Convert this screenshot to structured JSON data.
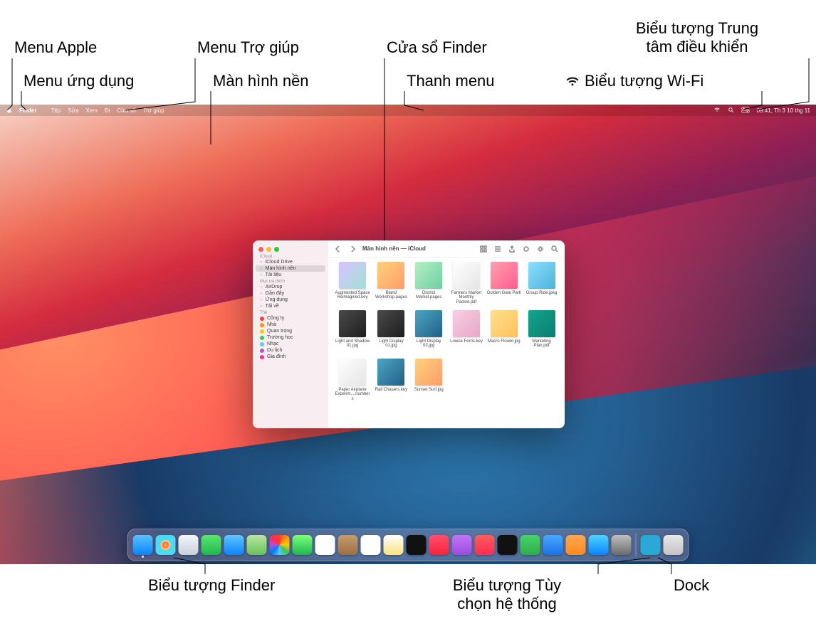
{
  "annotations": {
    "apple_menu": "Menu Apple",
    "app_menu": "Menu ứng dụng",
    "help_menu": "Menu Trợ giúp",
    "desktop": "Màn hình nền",
    "finder_window": "Cửa sổ Finder",
    "menu_bar": "Thanh menu",
    "control_center_l1": "Biểu tượng Trung",
    "control_center_l2": "tâm điều khiển",
    "wifi_icon": "Biểu tượng Wi-Fi",
    "finder_icon": "Biểu tượng Finder",
    "syspref_l1": "Biểu tượng Tùy",
    "syspref_l2": "chọn hệ thống",
    "dock": "Dock"
  },
  "menubar": {
    "app_name": "Finder",
    "items": [
      "Tệp",
      "Sửa",
      "Xem",
      "Đi",
      "Cửa sổ",
      "Trợ giúp"
    ],
    "clock": "09:41, Th 3 10 thg 11"
  },
  "finder": {
    "title": "Màn hình nền — iCloud",
    "sidebar": {
      "section_icloud": "iCloud",
      "icloud_items": [
        "iCloud Drive",
        "Màn hình nền",
        "Tài liệu"
      ],
      "section_fav": "Mục ưa thích",
      "fav_items": [
        "AirDrop",
        "Gần đây",
        "Ứng dụng",
        "Tải về"
      ],
      "section_tags": "Thẻ",
      "tags": [
        {
          "label": "Công ty",
          "color": "#ff3b30"
        },
        {
          "label": "Nhà",
          "color": "#ff9500"
        },
        {
          "label": "Quan trọng",
          "color": "#ffcc00"
        },
        {
          "label": "Trường học",
          "color": "#34c759"
        },
        {
          "label": "Nhạc",
          "color": "#5ac8fa"
        },
        {
          "label": "Du lịch",
          "color": "#af52de"
        },
        {
          "label": "Gia đình",
          "color": "#ff2d92"
        }
      ]
    },
    "files": [
      {
        "name": "Augmented Space Reimagined.key",
        "t": "t1"
      },
      {
        "name": "Bland Workshop.pages",
        "t": "t2"
      },
      {
        "name": "District Market.pages",
        "t": "t3"
      },
      {
        "name": "Farmers Market Monthly Packet.pdf",
        "t": "t4"
      },
      {
        "name": "Golden Gate Park",
        "t": "t5"
      },
      {
        "name": "Group Ride.jpeg",
        "t": "t6"
      },
      {
        "name": "Light and Shadow 01.jpg",
        "t": "t7"
      },
      {
        "name": "Light Display 01.jpg",
        "t": "t7"
      },
      {
        "name": "Light Display 03.jpg",
        "t": "t8"
      },
      {
        "name": "Louise Ferris.key",
        "t": "t9"
      },
      {
        "name": "Macro Flower.jpg",
        "t": "t10"
      },
      {
        "name": "Marketing Plan.pdf",
        "t": "t11"
      },
      {
        "name": "Paper Airplane Experim....numbers",
        "t": "t4"
      },
      {
        "name": "Rail Chasers.key",
        "t": "t8"
      },
      {
        "name": "Sunset Surf.jpg",
        "t": "t2"
      }
    ]
  },
  "dock": {
    "apps": [
      {
        "name": "Finder",
        "cls": "a-finder",
        "running": true
      },
      {
        "name": "Launchpad",
        "cls": "a-launch"
      },
      {
        "name": "Safari",
        "cls": "a-safari"
      },
      {
        "name": "Messages",
        "cls": "a-msg"
      },
      {
        "name": "Mail",
        "cls": "a-mail"
      },
      {
        "name": "Maps",
        "cls": "a-maps"
      },
      {
        "name": "Photos",
        "cls": "a-photo"
      },
      {
        "name": "FaceTime",
        "cls": "a-ft"
      },
      {
        "name": "Calendar",
        "cls": "a-cal"
      },
      {
        "name": "Contacts",
        "cls": "a-contacts"
      },
      {
        "name": "Reminders",
        "cls": "a-remind"
      },
      {
        "name": "Notes",
        "cls": "a-notes"
      },
      {
        "name": "TV",
        "cls": "a-tv"
      },
      {
        "name": "Music",
        "cls": "a-music"
      },
      {
        "name": "Podcasts",
        "cls": "a-pod"
      },
      {
        "name": "News",
        "cls": "a-news"
      },
      {
        "name": "Stocks",
        "cls": "a-stocks"
      },
      {
        "name": "Numbers",
        "cls": "a-num"
      },
      {
        "name": "Keynote",
        "cls": "a-key"
      },
      {
        "name": "Pages",
        "cls": "a-pages"
      },
      {
        "name": "App Store",
        "cls": "a-store"
      },
      {
        "name": "System Preferences",
        "cls": "a-pref"
      }
    ],
    "right": [
      {
        "name": "Downloads",
        "cls": "a-dl"
      },
      {
        "name": "Trash",
        "cls": "a-trash"
      }
    ]
  }
}
